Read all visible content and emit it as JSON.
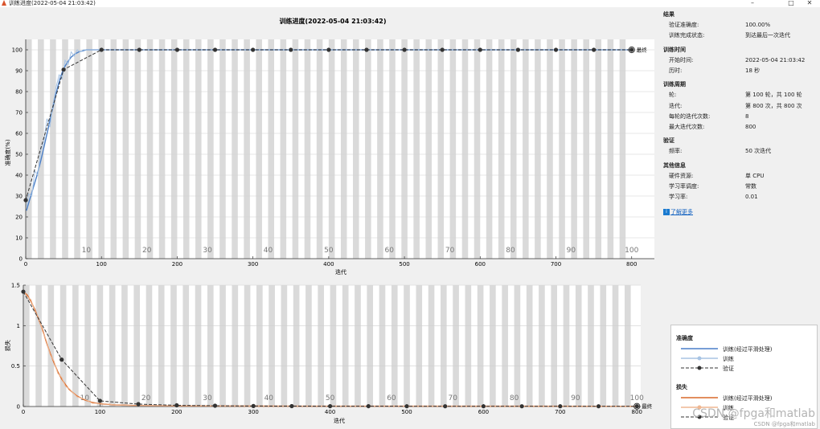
{
  "window": {
    "title": "训练进度(2022-05-04 21:03:42)",
    "min_icon": "minimize-icon",
    "max_icon": "maximize-icon",
    "close_icon": "close-icon"
  },
  "colors": {
    "acc_smoothed": "#4a7fc8",
    "acc_raw": "#a8c4e4",
    "loss_smoothed": "#d8692a",
    "loss_raw": "#efb792",
    "validation": "#333333",
    "epoch_shade": "#dadada",
    "plot_bg": "#ffffff"
  },
  "chart_data": [
    {
      "type": "line",
      "title": "训练进度(2022-05-04 21:03:42)",
      "xlabel": "迭代",
      "ylabel": "准确度(%)",
      "xlim": [
        0,
        830
      ],
      "ylim": [
        0,
        105
      ],
      "xticks": [
        0,
        100,
        200,
        300,
        400,
        500,
        600,
        700,
        800
      ],
      "yticks": [
        0,
        10,
        20,
        30,
        40,
        50,
        60,
        70,
        80,
        90,
        100
      ],
      "epoch_labels": [
        {
          "x": 80,
          "label": "10"
        },
        {
          "x": 160,
          "label": "20"
        },
        {
          "x": 240,
          "label": "30"
        },
        {
          "x": 320,
          "label": "40"
        },
        {
          "x": 400,
          "label": "50"
        },
        {
          "x": 480,
          "label": "60"
        },
        {
          "x": 560,
          "label": "70"
        },
        {
          "x": 640,
          "label": "80"
        },
        {
          "x": 720,
          "label": "90"
        },
        {
          "x": 800,
          "label": "100"
        }
      ],
      "final_label": "最终",
      "series": [
        {
          "name": "训练(经过平滑处理)",
          "style": "smoothed_acc",
          "x": [
            1,
            5,
            10,
            15,
            20,
            25,
            30,
            35,
            40,
            45,
            50,
            55,
            60,
            65,
            70,
            75,
            80,
            85,
            90,
            95,
            100,
            800
          ],
          "y": [
            23,
            28,
            34,
            40,
            47,
            55,
            63,
            71,
            79,
            86,
            91,
            94,
            96.5,
            98,
            99,
            99.5,
            100,
            100,
            100,
            100,
            100,
            100
          ]
        },
        {
          "name": "训练",
          "style": "raw_acc",
          "x": [
            1,
            4,
            8,
            12,
            16,
            20,
            24,
            28,
            32,
            36,
            40,
            44,
            48,
            52,
            56,
            60,
            64,
            68,
            72,
            76,
            80,
            84,
            88,
            92,
            96,
            100,
            800
          ],
          "y": [
            25,
            31,
            30,
            42,
            40,
            52,
            56,
            67,
            63,
            74,
            82,
            88,
            86,
            95,
            93,
            99,
            97,
            100,
            99,
            100,
            100,
            100,
            100,
            100,
            100,
            100,
            100
          ]
        },
        {
          "name": "验证",
          "style": "validation",
          "x": [
            0,
            50,
            100,
            150,
            200,
            250,
            300,
            350,
            400,
            450,
            500,
            550,
            600,
            650,
            700,
            750,
            800
          ],
          "y": [
            28,
            90.5,
            100,
            100,
            100,
            100,
            100,
            100,
            100,
            100,
            100,
            100,
            100,
            100,
            100,
            100,
            100
          ]
        }
      ]
    },
    {
      "type": "line",
      "title": "",
      "xlabel": "迭代",
      "ylabel": "损失",
      "xlim": [
        0,
        805
      ],
      "ylim": [
        0,
        1.5
      ],
      "xticks": [
        0,
        100,
        200,
        300,
        400,
        500,
        600,
        700,
        800
      ],
      "yticks": [
        0,
        0.5,
        1,
        1.5
      ],
      "epoch_labels": [
        {
          "x": 80,
          "label": "10"
        },
        {
          "x": 160,
          "label": "20"
        },
        {
          "x": 240,
          "label": "30"
        },
        {
          "x": 320,
          "label": "40"
        },
        {
          "x": 400,
          "label": "50"
        },
        {
          "x": 480,
          "label": "60"
        },
        {
          "x": 560,
          "label": "70"
        },
        {
          "x": 640,
          "label": "80"
        },
        {
          "x": 720,
          "label": "90"
        },
        {
          "x": 800,
          "label": "100"
        }
      ],
      "final_label": "最终",
      "series": [
        {
          "name": "训练(经过平滑处理)",
          "style": "smoothed_loss",
          "x": [
            0,
            5,
            10,
            15,
            20,
            25,
            30,
            35,
            40,
            45,
            50,
            55,
            60,
            70,
            80,
            90,
            100,
            120,
            150,
            200,
            300,
            800
          ],
          "y": [
            1.42,
            1.38,
            1.3,
            1.2,
            1.08,
            0.95,
            0.8,
            0.66,
            0.54,
            0.43,
            0.34,
            0.27,
            0.21,
            0.13,
            0.08,
            0.05,
            0.035,
            0.02,
            0.012,
            0.008,
            0.005,
            0.003
          ]
        },
        {
          "name": "训练",
          "style": "raw_loss",
          "x": [
            0,
            5,
            10,
            15,
            20,
            25,
            30,
            35,
            40,
            45,
            50,
            55,
            60,
            70,
            80,
            90,
            100,
            120,
            150,
            200,
            300,
            800
          ],
          "y": [
            1.43,
            1.36,
            1.32,
            1.18,
            1.1,
            0.93,
            0.82,
            0.64,
            0.56,
            0.41,
            0.36,
            0.25,
            0.22,
            0.12,
            0.09,
            0.04,
            0.04,
            0.02,
            0.01,
            0.01,
            0.004,
            0.003
          ]
        },
        {
          "name": "验证",
          "style": "validation",
          "x": [
            0,
            50,
            100,
            150,
            200,
            250,
            300,
            350,
            400,
            450,
            500,
            550,
            600,
            650,
            700,
            750,
            800
          ],
          "y": [
            1.42,
            0.58,
            0.07,
            0.03,
            0.015,
            0.01,
            0.006,
            0.005,
            0.004,
            0.004,
            0.003,
            0.003,
            0.003,
            0.003,
            0.003,
            0.003,
            0.003
          ]
        }
      ]
    }
  ],
  "panel": {
    "result": {
      "title": "结果",
      "rows": [
        {
          "k": "验证准确度:",
          "v": "100.00%"
        },
        {
          "k": "训练完成状态:",
          "v": "到达最后一次迭代"
        }
      ]
    },
    "time": {
      "title": "训练时间",
      "rows": [
        {
          "k": "开始时间:",
          "v": "2022-05-04 21:03:42"
        },
        {
          "k": "历时:",
          "v": "18 秒"
        }
      ]
    },
    "cycle": {
      "title": "训练周期",
      "rows": [
        {
          "k": "轮:",
          "v": "第 100 轮，共 100 轮"
        },
        {
          "k": "迭代:",
          "v": "第 800 次，共 800 次"
        },
        {
          "k": "每轮的迭代次数:",
          "v": "8"
        },
        {
          "k": "最大迭代次数:",
          "v": "800"
        }
      ]
    },
    "validation": {
      "title": "验证",
      "rows": [
        {
          "k": "频率:",
          "v": "50 次迭代"
        }
      ]
    },
    "other": {
      "title": "其他信息",
      "rows": [
        {
          "k": "硬件资源:",
          "v": "单 CPU"
        },
        {
          "k": "学习率调度:",
          "v": "常数"
        },
        {
          "k": "学习率:",
          "v": "0.01"
        }
      ]
    },
    "link": "了解更多",
    "link_icon": "info-icon"
  },
  "legend": {
    "acc_title": "准确度",
    "acc_smoothed": "训练(经过平滑处理)",
    "acc_raw": "训练",
    "acc_val": "验证",
    "loss_title": "损失",
    "loss_smoothed": "训练(经过平滑处理)",
    "loss_raw": "训练",
    "loss_val": "验证"
  },
  "watermark": "CSDN @fpga和matlab",
  "watermark2": "CSDN @fpga和matlab"
}
